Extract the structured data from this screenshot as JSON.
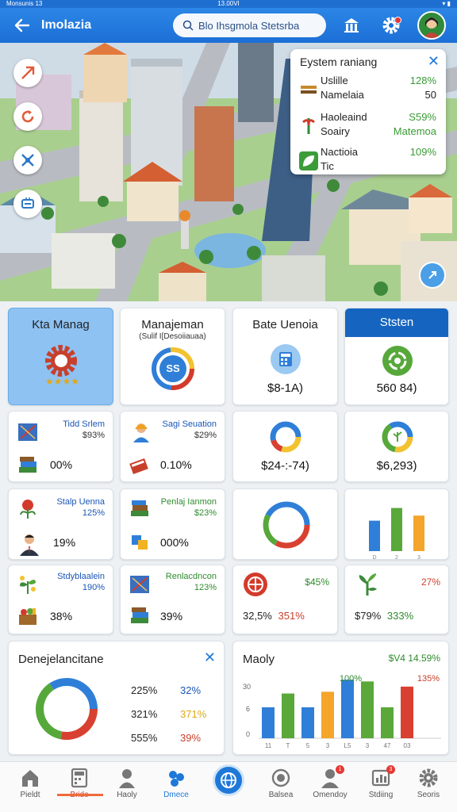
{
  "status": {
    "left": "Monsunis 13",
    "center": "13.00VI"
  },
  "appbar": {
    "title": "Imolazia",
    "search_placeholder": "Blo Ihsgmola Stetsrba"
  },
  "system_panel": {
    "title": "Eystem raniang",
    "rows": [
      {
        "label1": "Uslille",
        "label2": "Namelaia",
        "value1": "128%",
        "value2": "50"
      },
      {
        "label1": "Haoleaind",
        "label2": "Soairy",
        "value1": "S59%",
        "value2": "Matemoa"
      },
      {
        "label1": "Nactioia",
        "label2": "Tic",
        "value1": "109%",
        "value2": ""
      }
    ]
  },
  "top_cards": [
    {
      "title": "Kta Manag",
      "sub": ""
    },
    {
      "title": "Manajeman",
      "sub": "(Sulif I[Desoiiauaa)",
      "gauge": "SS"
    },
    {
      "title": "Bate Uenoia",
      "value": "$8-1A)"
    },
    {
      "title": "Ststen",
      "value": "560 84)"
    }
  ],
  "mini_cards": [
    {
      "label": "Tidd Srlem",
      "pct": "$93%",
      "big": "00%"
    },
    {
      "label": "Sagi Seuation",
      "pct": "$29%",
      "big": "0.10%"
    },
    {
      "label": "Stalp Uenna",
      "pct": "125%",
      "big": "19%"
    },
    {
      "label": "Penlaj Ianmon",
      "pct": "$23%",
      "big": "000%"
    },
    {
      "label": "Stdyblaalein",
      "pct": "190%",
      "big": "38%"
    },
    {
      "label": "Renlacdncon",
      "pct": "123%",
      "big": "39%"
    }
  ],
  "right_cards": {
    "donut_value_1": "$24-:-74)",
    "donut_value_2": "$6,293)",
    "stat_a_pct": "$45%",
    "stat_a_values": [
      "32,5%",
      "351%"
    ],
    "stat_b_pct": "27%",
    "stat_b_values": [
      "$79%",
      "333%"
    ]
  },
  "bottom_left": {
    "title": "Denejelancitane",
    "legend": [
      {
        "a": "225%",
        "b": "32%"
      },
      {
        "a": "321%",
        "b": "371%"
      },
      {
        "a": "555%",
        "b": "39%"
      }
    ]
  },
  "bottom_right": {
    "title": "Maoly",
    "value": "$V4 14.59%",
    "annot_green": "100%",
    "annot_red": "135%",
    "ytick_top": "30",
    "ytick_mid": "6",
    "ytick_bottom": "0",
    "xticks": [
      "11",
      "T",
      "5",
      "3",
      "L5",
      "3",
      "47",
      "03"
    ]
  },
  "colors": {
    "blue": "#2f7fd8",
    "green": "#5aa83a",
    "orange": "#f4a52a",
    "red": "#d84131",
    "yellow": "#f2c230"
  },
  "mini_bar_chart": {
    "type": "bar",
    "categories": [
      "D",
      "2",
      "3"
    ],
    "values": [
      48,
      68,
      56
    ],
    "ylim": [
      0,
      80
    ]
  },
  "chart_data": {
    "type": "bar",
    "categories": [
      "11",
      "T",
      "5",
      "3",
      "L5",
      "3",
      "47",
      "03"
    ],
    "values": [
      18,
      26,
      18,
      27,
      34,
      33,
      18,
      30
    ],
    "ylim": [
      0,
      35
    ]
  },
  "bottom_nav": [
    {
      "label": "Pieldt",
      "icon": "home-icon"
    },
    {
      "label": "Bride",
      "icon": "calculator-icon"
    },
    {
      "label": "Haoly",
      "icon": "person-icon"
    },
    {
      "label": "Dmece",
      "icon": "network-icon"
    },
    {
      "label": "Balsea",
      "icon": "globe-badge-icon"
    },
    {
      "label": "Omendoy",
      "icon": "people-icon"
    },
    {
      "label": "Stdiing",
      "icon": "chart-icon"
    },
    {
      "label": "Seoris",
      "icon": "gear-icon"
    }
  ]
}
